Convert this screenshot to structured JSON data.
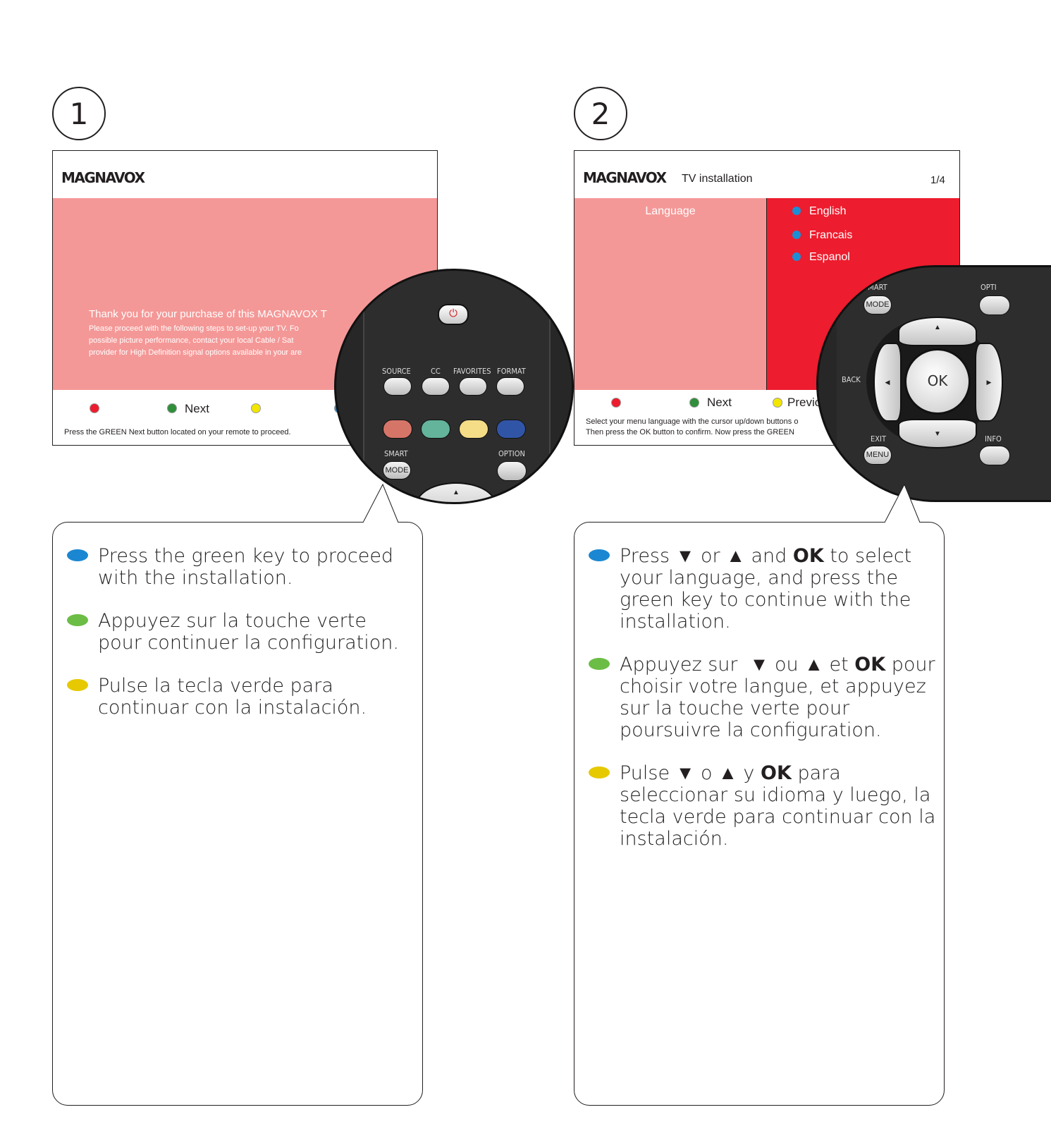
{
  "step1": {
    "number": "1",
    "screen": {
      "brand": "MAGNAVOX",
      "message_title": "Thank you for your purchase of this MAGNAVOX T",
      "message_lines": [
        "Please proceed with the following steps to set-up your TV. Fo",
        "possible picture performance, contact your local Cable / Sat",
        "provider for High Definition signal options available in your are"
      ],
      "next_label": "Next",
      "hint": "Press the GREEN Next button located on your remote to proceed."
    },
    "remote": {
      "labels": [
        "SOURCE",
        "CC",
        "FAVORITES",
        "FORMAT",
        "SMART",
        "MODE",
        "OPTION"
      ]
    },
    "instructions": [
      "Press the green key to proceed with the installation.",
      "Appuyez sur la touche verte pour continuer la configuration.",
      "Pulse la tecla verde para continuar con la instalación."
    ]
  },
  "step2": {
    "number": "2",
    "screen": {
      "brand": "MAGNAVOX",
      "title": "TV installation",
      "page": "1/4",
      "left_label": "Language",
      "options": [
        "English",
        "Francais",
        "Espanol"
      ],
      "next_label": "Next",
      "previous_label": "Previous",
      "hint_lines": [
        "Select your menu language with the cursor up/down buttons o",
        "Then press the OK button to confirm. Now press the GREEN"
      ]
    },
    "remote": {
      "labels": [
        "SMART",
        "MODE",
        "OPTI",
        "BACK",
        "OK",
        "EXIT",
        "MENU",
        "INFO"
      ]
    },
    "instructions": [
      {
        "pre": "Press ",
        "down": "▼",
        "mid1": " or ",
        "up": "▲",
        "mid2": " and ",
        "ok": "OK",
        "post": " to select your language, and press the green key to continue with the installation."
      },
      {
        "pre": "Appuyez sur  ",
        "down": "▼",
        "mid1": " ou ",
        "up": "▲",
        "mid2": " et ",
        "ok": "OK",
        "post": " pour choisir votre langue, et appuyez sur la touche verte pour poursuivre la configuration."
      },
      {
        "pre": "Pulse ",
        "down": "▼",
        "mid1": " o ",
        "up": "▲",
        "mid2": " y ",
        "ok": "OK",
        "post": " para seleccionar su idioma y luego, la tecla verde para continuar con la instalación."
      }
    ]
  },
  "colors": {
    "red_key": "#ed1c2e",
    "green_key": "#2f8f3a",
    "yellow_key": "#f2e600",
    "blue_key": "#1b8fd6",
    "bullet_blue": "#1b87d2",
    "bullet_green": "#6cbd45",
    "bullet_yellow": "#e6c900",
    "screen_pink": "#f49897",
    "screen_red": "#ed1c2e"
  }
}
